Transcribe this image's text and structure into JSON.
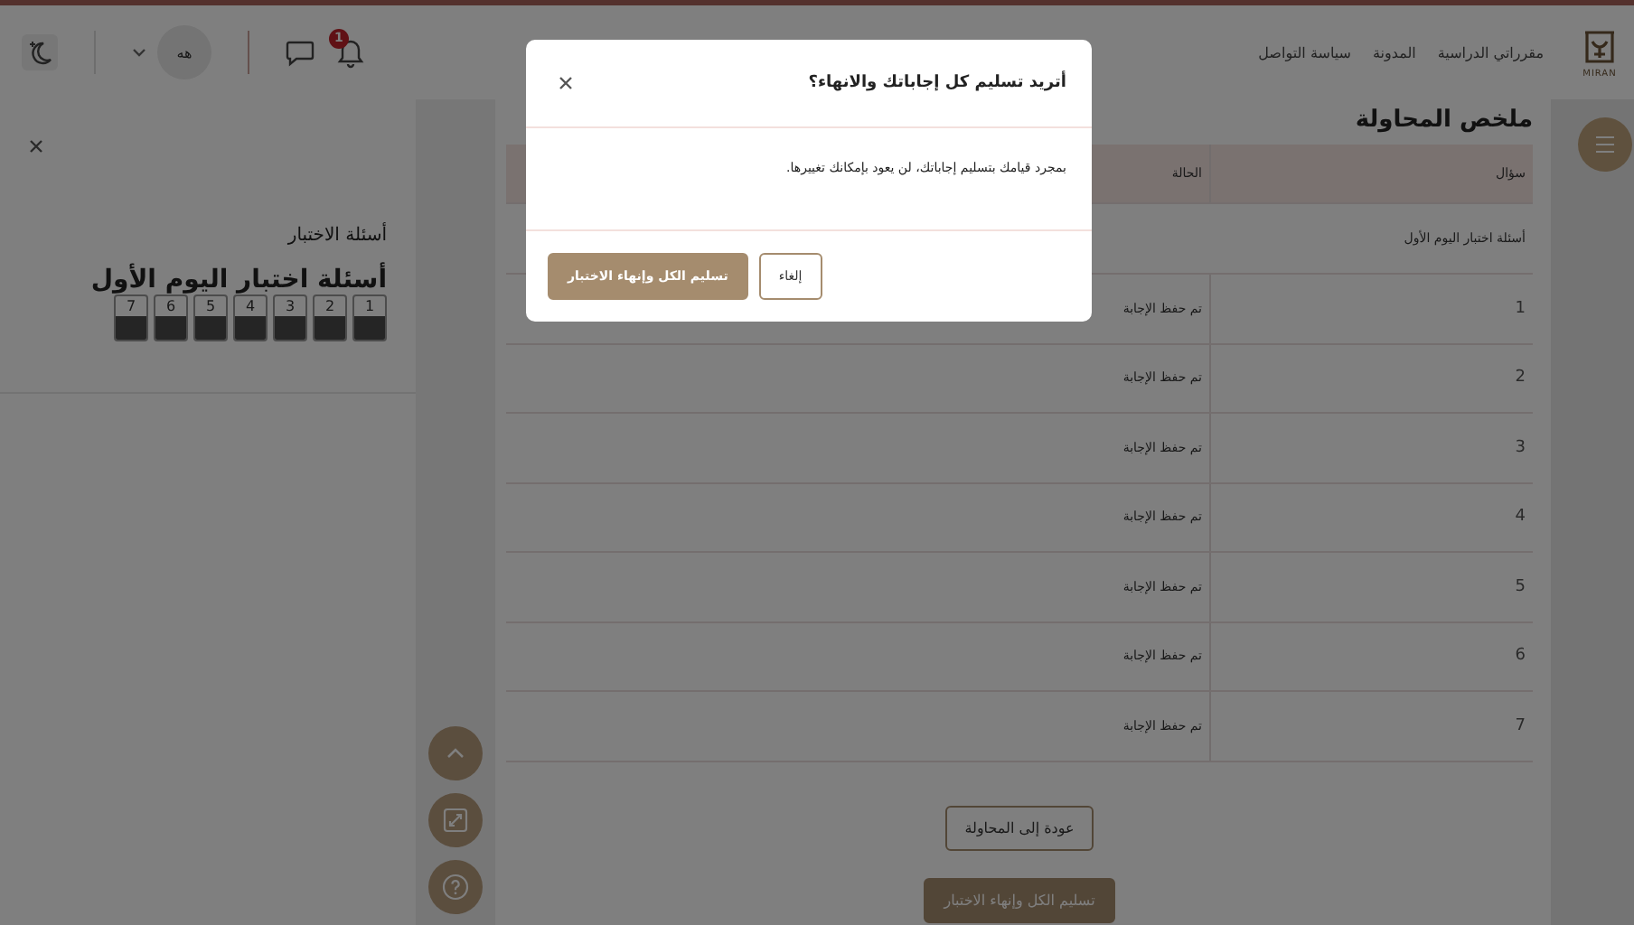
{
  "header": {
    "logo_text": "MIRAN",
    "nav": [
      "مقرراتي الدراسية",
      "المدونة",
      "سياسة التواصل"
    ],
    "notifications_badge": "1",
    "avatar_initials": "هه"
  },
  "drawer": {
    "title": "أسئلة الاختبار",
    "quiz_name": "أسئلة اختبار اليوم الأول",
    "questions": [
      {
        "label": "1",
        "answered": true
      },
      {
        "label": "2",
        "answered": true
      },
      {
        "label": "3",
        "answered": true
      },
      {
        "label": "4",
        "answered": true
      },
      {
        "label": "5",
        "answered": true
      },
      {
        "label": "6",
        "answered": true
      },
      {
        "label": "7",
        "answered": true
      }
    ]
  },
  "summary": {
    "title": "ملخص المحاولة",
    "columns": [
      "سؤال",
      "الحالة"
    ],
    "section": "أسئلة اختبار اليوم الأول",
    "rows": [
      {
        "question": "1",
        "status": "تم حفظ الإجابة"
      },
      {
        "question": "2",
        "status": "تم حفظ الإجابة"
      },
      {
        "question": "3",
        "status": "تم حفظ الإجابة"
      },
      {
        "question": "4",
        "status": "تم حفظ الإجابة"
      },
      {
        "question": "5",
        "status": "تم حفظ الإجابة"
      },
      {
        "question": "6",
        "status": "تم حفظ الإجابة"
      },
      {
        "question": "7",
        "status": "تم حفظ الإجابة"
      }
    ],
    "buttons": [
      "عودة إلى المحاولة",
      "تسليم الكل وإنهاء الاختبار"
    ]
  },
  "dialog": {
    "title": "أتريد تسليم كل إجاباتك والانهاء؟",
    "message": "بمجرد قيامك بتسليم إجاباتك، لن يعود بإمكانك تغييرها.",
    "buttons": [
      "إلغاء",
      "تسليم الكل وإنهاء الاختبار"
    ]
  }
}
